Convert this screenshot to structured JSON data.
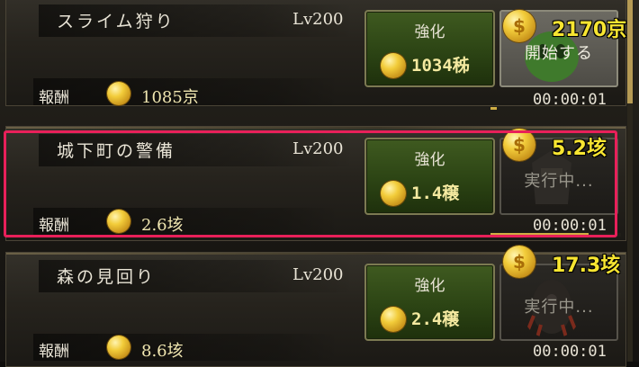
{
  "labels": {
    "reward": "報酬",
    "upgrade": "強化",
    "coin_symbol": "$"
  },
  "quests": [
    {
      "title": "スライム狩り",
      "level": "Lv200",
      "reward": "1085京",
      "upgrade_cost": "1034秭",
      "action_label": "開始する",
      "action_state": "ready",
      "timer": "00:00:01",
      "prize": "2170京",
      "progress": 0.05
    },
    {
      "title": "城下町の警備",
      "level": "Lv200",
      "reward": "2.6垓",
      "upgrade_cost": "1.4穣",
      "action_label": "実行中...",
      "action_state": "running",
      "timer": "00:00:01",
      "prize": "5.2垓",
      "progress": 0.75,
      "highlighted": true
    },
    {
      "title": "森の見回り",
      "level": "Lv200",
      "reward": "8.6垓",
      "upgrade_cost": "2.4穣",
      "action_label": "実行中...",
      "action_state": "running",
      "timer": "00:00:01",
      "prize": "17.3垓",
      "progress": 0.0
    }
  ],
  "colors": {
    "highlight": "#e8205a",
    "prize_text": "#f7e531",
    "upgrade_button": "#2c4414",
    "coin": "#f2cc3a"
  },
  "icons": [
    "gold-coin-icon",
    "slime-icon",
    "guard-icon",
    "forest-monster-icon"
  ]
}
